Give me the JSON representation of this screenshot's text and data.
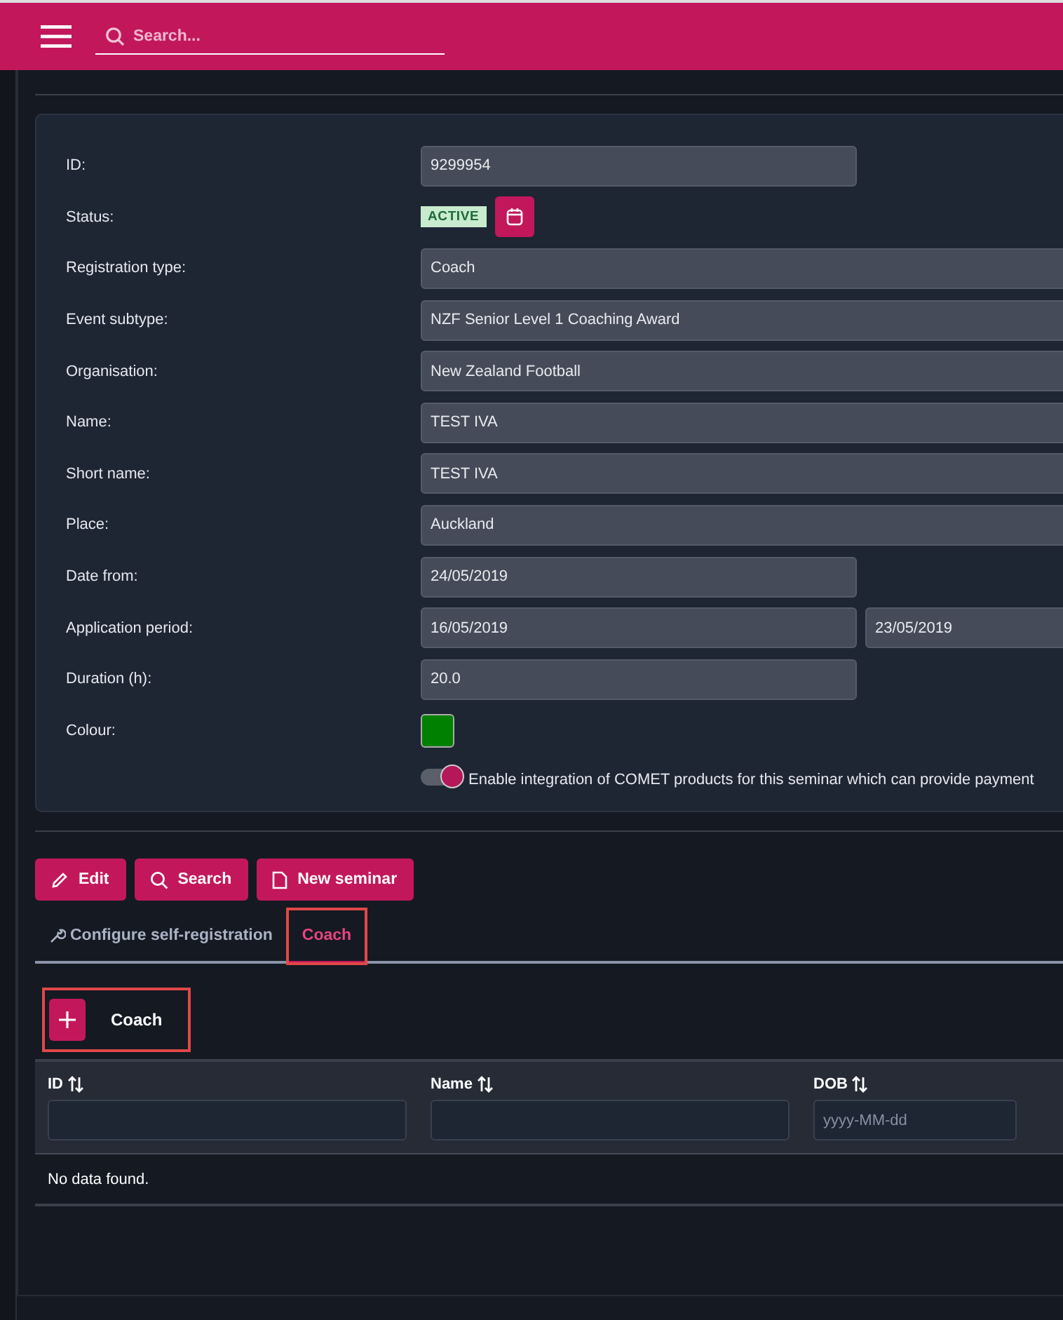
{
  "header": {
    "search": {
      "placeholder": "Search..."
    }
  },
  "form": [
    {
      "label": "ID:",
      "kind": "short",
      "value": "9299954"
    },
    {
      "label": "Status:",
      "kind": "status",
      "badge": "ACTIVE"
    },
    {
      "label": "Registration type:",
      "kind": "long",
      "value": "Coach"
    },
    {
      "label": "Event subtype:",
      "kind": "long",
      "value": "NZF Senior Level 1 Coaching Award"
    },
    {
      "label": "Organisation:",
      "kind": "long",
      "value": "New Zealand Football"
    },
    {
      "label": "Name:",
      "kind": "long",
      "value": "TEST IVA"
    },
    {
      "label": "Short name:",
      "kind": "long",
      "value": "TEST IVA"
    },
    {
      "label": "Place:",
      "kind": "long",
      "value": "Auckland"
    },
    {
      "label": "Date from:",
      "kind": "short",
      "value": "24/05/2019"
    },
    {
      "label": "Application period:",
      "kind": "range",
      "value": "16/05/2019",
      "value_to": "23/05/2019"
    },
    {
      "label": "Duration (h):",
      "kind": "short",
      "value": "20.0"
    },
    {
      "label": "Colour:",
      "kind": "color",
      "color": "#008000"
    }
  ],
  "comet_toggle": {
    "on": true,
    "label": "Enable integration of COMET products for this seminar which can provide payment"
  },
  "actions": [
    {
      "label": "Edit",
      "kind": "edit"
    },
    {
      "label": "Search",
      "kind": "search"
    },
    {
      "label": "New seminar",
      "kind": "new"
    }
  ],
  "tabs": [
    {
      "label": "Configure self-registration",
      "selected": false,
      "highlighted": false,
      "kind": "wrench"
    },
    {
      "label": "Coach",
      "selected": true,
      "highlighted": true,
      "kind": "plain"
    }
  ],
  "add_button": {
    "label": "Coach",
    "highlighted": true
  },
  "table": {
    "columns": [
      {
        "title": "ID"
      },
      {
        "title": "Name"
      },
      {
        "title": "DOB",
        "placeholder": "yyyy-MM-dd"
      }
    ],
    "empty_message": "No data found."
  }
}
